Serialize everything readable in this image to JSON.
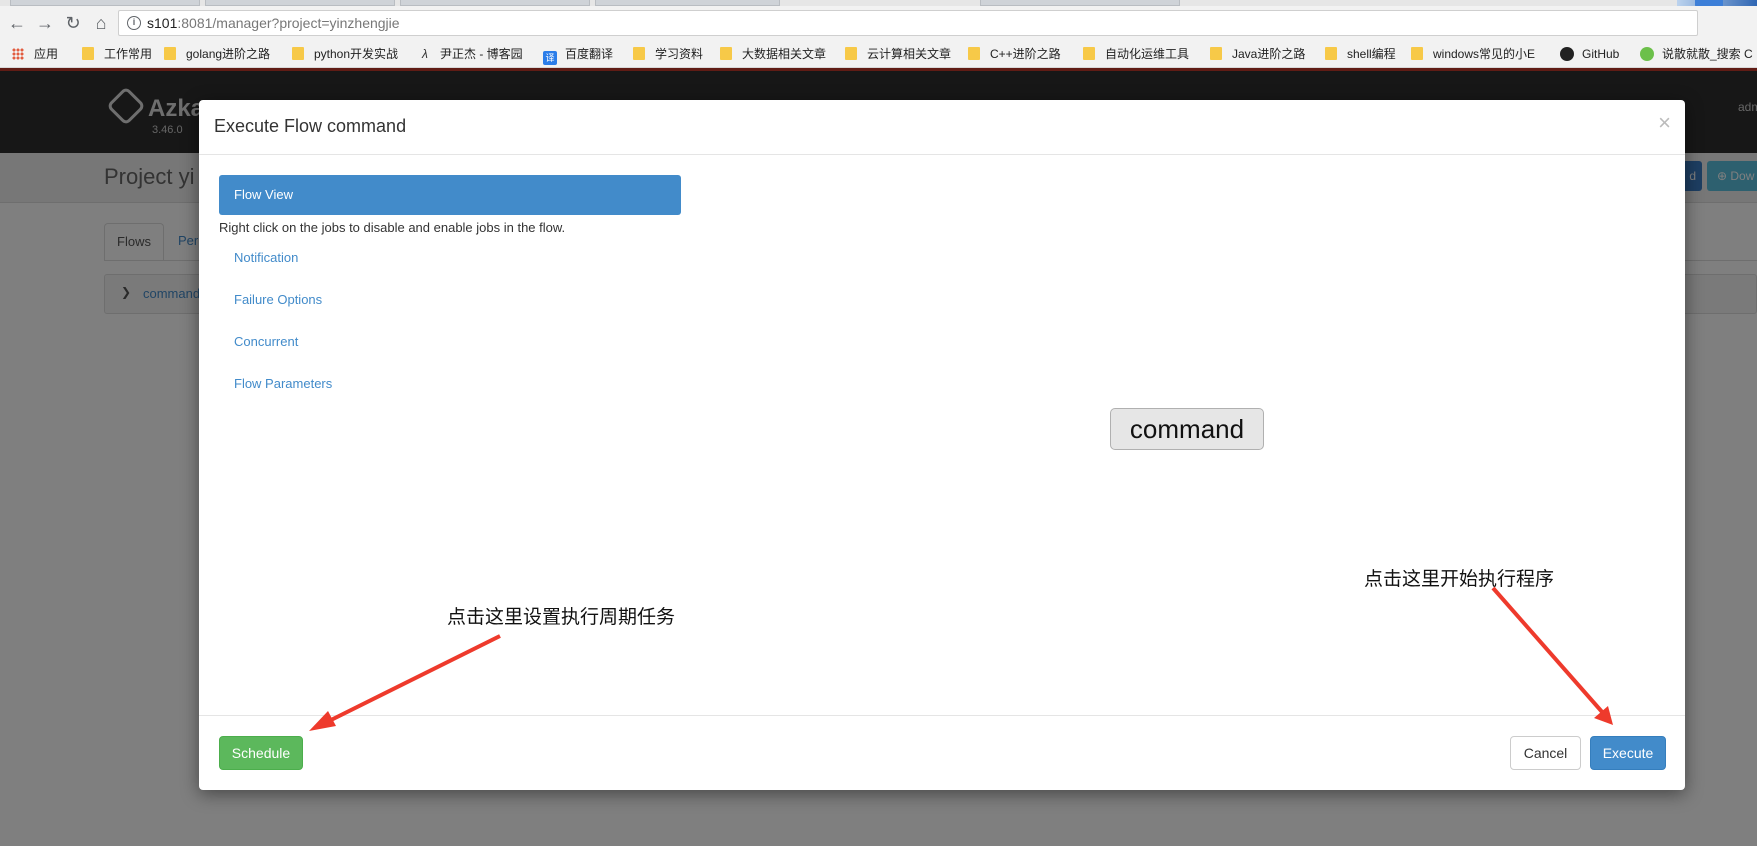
{
  "browser": {
    "url_host": "s101",
    "url_rest": ":8081/manager?project=yinzhengjie",
    "bookmarks": [
      {
        "label": "应用",
        "icon": "apps-grid-icon"
      },
      {
        "label": "工作常用",
        "icon": "folder-icon"
      },
      {
        "label": "golang进阶之路",
        "icon": "folder-icon"
      },
      {
        "label": "python开发实战",
        "icon": "folder-icon"
      },
      {
        "label": "尹正杰 - 博客园",
        "icon": "cnblogs-icon"
      },
      {
        "label": "百度翻译",
        "icon": "translate-icon"
      },
      {
        "label": "学习资料",
        "icon": "folder-icon"
      },
      {
        "label": "大数据相关文章",
        "icon": "folder-icon"
      },
      {
        "label": "云计算相关文章",
        "icon": "folder-icon"
      },
      {
        "label": "C++进阶之路",
        "icon": "folder-icon"
      },
      {
        "label": "自动化运维工具",
        "icon": "folder-icon"
      },
      {
        "label": "Java进阶之路",
        "icon": "folder-icon"
      },
      {
        "label": "shell编程",
        "icon": "folder-icon"
      },
      {
        "label": "windows常见的小E",
        "icon": "folder-icon"
      },
      {
        "label": "GitHub",
        "icon": "github-icon"
      },
      {
        "label": "说散就散_搜索 C",
        "icon": "site-icon"
      }
    ]
  },
  "app": {
    "logo_text": "Azka",
    "version": "3.46.0",
    "user": "adm",
    "project_title": "Project yi",
    "header_btn1": "d",
    "header_btn2": "Dow",
    "tabs": {
      "flows": "Flows",
      "permissions": "Per"
    },
    "flow_row_name": "command"
  },
  "modal": {
    "title": "Execute Flow command",
    "close": "×",
    "nav": {
      "active": "Flow View",
      "hint": "Right click on the jobs to disable and enable jobs in the flow.",
      "links": [
        "Notification",
        "Failure Options",
        "Concurrent",
        "Flow Parameters"
      ]
    },
    "graph_node": "command",
    "buttons": {
      "schedule": "Schedule",
      "cancel": "Cancel",
      "execute": "Execute"
    }
  },
  "annotations": {
    "schedule_note": "点击这里设置执行周期任务",
    "execute_note": "点击这里开始执行程序",
    "arrow_color": "#ee3a2c"
  }
}
